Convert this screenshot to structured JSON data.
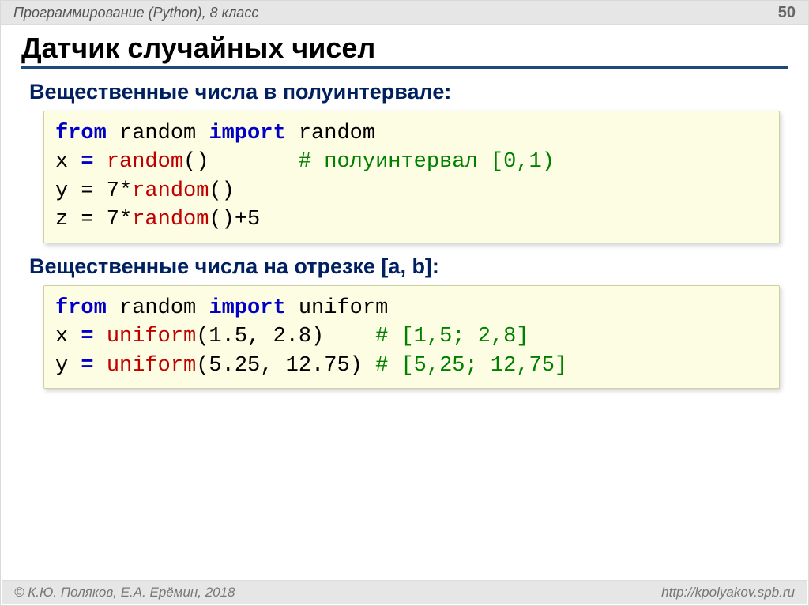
{
  "header": {
    "course": "Программирование (Python), 8 класс",
    "page": "50"
  },
  "title": "Датчик случайных чисел",
  "section1": {
    "heading": "Вещественные числа в полуинтервале:",
    "code": {
      "l1_kw1": "from",
      "l1_t1": " random ",
      "l1_kw2": "import",
      "l1_t2": " random",
      "l2_t1": "x ",
      "l2_op": "=",
      "l2_sp": " ",
      "l2_fn": "random",
      "l2_t2": "()       ",
      "l2_cm": "# полуинтервал [0,1)",
      "l3_t1": "y = 7*",
      "l3_fn": "random",
      "l3_t2": "()",
      "l4_t1": "z = 7*",
      "l4_fn": "random",
      "l4_t2": "()+5"
    }
  },
  "section2": {
    "heading": "Вещественные числа на отрезке [a, b]:",
    "code": {
      "l1_kw1": "from",
      "l1_t1": " random ",
      "l1_kw2": "import",
      "l1_t2": " uniform",
      "l2_t1": "x ",
      "l2_op": "=",
      "l2_sp": " ",
      "l2_fn": "uniform",
      "l2_t2": "(1.5, 2.8)    ",
      "l2_cm": "# [1,5; 2,8]",
      "l3_t1": "y ",
      "l3_op": "=",
      "l3_sp": " ",
      "l3_fn": "uniform",
      "l3_t2": "(5.25, 12.75) ",
      "l3_cm": "# [5,25; 12,75]"
    }
  },
  "footer": {
    "copyright": "© К.Ю. Поляков, Е.А. Ерёмин, 2018",
    "url": "http://kpolyakov.spb.ru"
  }
}
